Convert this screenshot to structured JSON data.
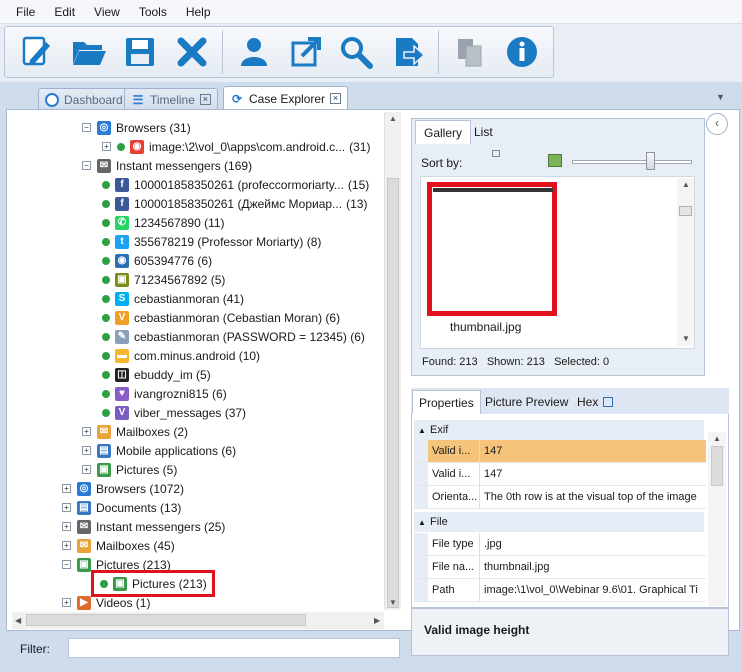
{
  "menu": [
    "File",
    "Edit",
    "View",
    "Tools",
    "Help"
  ],
  "toolbar_icons": [
    "edit-icon",
    "open-folder-icon",
    "save-icon",
    "delete-icon",
    "user-icon",
    "export-icon",
    "search-icon",
    "import-icon",
    "copy-icon",
    "info-icon"
  ],
  "tabs": [
    {
      "label": "Dashboard"
    },
    {
      "label": "Timeline"
    },
    {
      "label": "Case Explorer"
    }
  ],
  "tree": [
    {
      "label": "Browsers (31)",
      "indent": 1,
      "exp": "⊟",
      "icon": "globe-icon",
      "color": "#2a7bd4"
    },
    {
      "label": "image:\\2\\vol_0\\apps\\com.android.c...",
      "count": "(31)",
      "indent": 2,
      "exp": "⊞",
      "dot": true,
      "icon": "chrome-icon",
      "color": "#e34133"
    },
    {
      "label": "Instant messengers (169)",
      "indent": 1,
      "exp": "⊟",
      "icon": "chat-icon",
      "color": "#666666"
    },
    {
      "label": "100001858350261 (profeccormoriarty...",
      "count": "(15)",
      "indent": 2,
      "dot": true,
      "icon": "facebook-icon",
      "color": "#3b5998"
    },
    {
      "label": "100001858350261 (Джеймс Мориар...",
      "count": "(13)",
      "indent": 2,
      "dot": true,
      "icon": "facebook-icon",
      "color": "#3b5998"
    },
    {
      "label": "1234567890 (11)",
      "indent": 2,
      "dot": true,
      "icon": "whatsapp-icon",
      "color": "#25d366"
    },
    {
      "label": "355678219 (Professor Moriarty) (8)",
      "indent": 2,
      "dot": true,
      "icon": "twitter-icon",
      "color": "#1da1f2"
    },
    {
      "label": "605394776 (6)",
      "indent": 2,
      "dot": true,
      "icon": "eye-icon",
      "color": "#2a6fb8"
    },
    {
      "label": "71234567892 (5)",
      "indent": 2,
      "dot": true,
      "icon": "robot-icon",
      "color": "#7a8d1a"
    },
    {
      "label": "cebastianmoran (41)",
      "indent": 2,
      "dot": true,
      "icon": "skype-icon",
      "color": "#00aff0"
    },
    {
      "label": "cebastianmoran (Cebastian Moran) (6)",
      "indent": 2,
      "dot": true,
      "icon": "viber-icon",
      "color": "#f0a028"
    },
    {
      "label": "cebastianmoran (PASSWORD = 12345) (6)",
      "indent": 2,
      "dot": true,
      "icon": "pin-icon",
      "color": "#8aa0b8"
    },
    {
      "label": "com.minus.android (10)",
      "indent": 2,
      "dot": true,
      "icon": "folder-icon",
      "color": "#f2b632"
    },
    {
      "label": "ebuddy_im (5)",
      "indent": 2,
      "dot": true,
      "icon": "ebuddy-icon",
      "color": "#222222"
    },
    {
      "label": "ivangrozni815 (6)",
      "indent": 2,
      "dot": true,
      "icon": "heart-icon",
      "color": "#8a5cc8"
    },
    {
      "label": "viber_messages (37)",
      "indent": 2,
      "dot": true,
      "icon": "viber-icon",
      "color": "#7b5cc4"
    },
    {
      "label": "Mailboxes (2)",
      "indent": 1,
      "exp": "⊞",
      "icon": "mail-icon",
      "color": "#e8a23a"
    },
    {
      "label": "Mobile applications (6)",
      "indent": 1,
      "exp": "⊞",
      "icon": "app-icon",
      "color": "#3a78c2"
    },
    {
      "label": "Pictures (5)",
      "indent": 1,
      "exp": "⊞",
      "icon": "picture-icon",
      "color": "#3a9a4a"
    },
    {
      "label": "Browsers (1072)",
      "indent": 0,
      "exp": "⊞",
      "icon": "globe-icon",
      "color": "#2a7bd4"
    },
    {
      "label": "Documents (13)",
      "indent": 0,
      "exp": "⊞",
      "icon": "document-icon",
      "color": "#3a78c2"
    },
    {
      "label": "Instant messengers (25)",
      "indent": 0,
      "exp": "⊞",
      "icon": "chat-icon",
      "color": "#666666"
    },
    {
      "label": "Mailboxes (45)",
      "indent": 0,
      "exp": "⊞",
      "icon": "mail-icon",
      "color": "#e8a23a"
    },
    {
      "label": "Pictures (213)",
      "indent": 0,
      "exp": "⊟",
      "icon": "picture-icon",
      "color": "#3a9a4a"
    },
    {
      "label": "Pictures (213)",
      "indent": 1,
      "dot": true,
      "icon": "picture-icon",
      "color": "#3a9a4a"
    },
    {
      "label": "Videos (1)",
      "indent": 0,
      "exp": "⊞",
      "icon": "video-icon",
      "color": "#e06a2a"
    }
  ],
  "filter": {
    "label": "Filter:",
    "value": ""
  },
  "gallery": {
    "tabs": [
      "Gallery",
      "List"
    ],
    "sort_label": "Sort by:",
    "thumbnail_name": "thumbnail.jpg",
    "status": "Found: 213   Shown: 213   Selected: 0"
  },
  "properties": {
    "tabs": [
      "Properties",
      "Picture Preview",
      "Hex"
    ],
    "sections": [
      {
        "title": "Exif",
        "rows": [
          {
            "key": "Valid i...",
            "value": "147",
            "selected": true
          },
          {
            "key": "Valid i...",
            "value": "147"
          },
          {
            "key": "Orienta...",
            "value": "The 0th row is at the visual top of the image"
          }
        ]
      },
      {
        "title": "File",
        "rows": [
          {
            "key": "File type",
            "value": ".jpg"
          },
          {
            "key": "File na...",
            "value": "thumbnail.jpg"
          },
          {
            "key": "Path",
            "value": "image:\\1\\vol_0\\Webinar 9.6\\01. Graphical Ti"
          }
        ]
      }
    ],
    "description": "Valid image height"
  },
  "colors": {
    "accent": "#e1121e",
    "selection": "#f5c47a",
    "online": "#2ea043"
  }
}
